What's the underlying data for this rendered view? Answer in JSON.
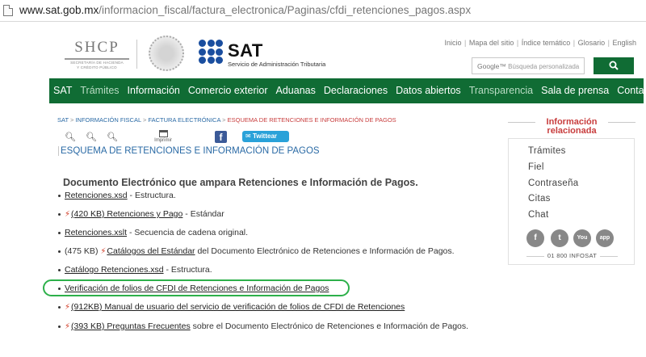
{
  "browser": {
    "url_host": "www.sat.gob.mx",
    "url_path": "/informacion_fiscal/factura_electronica/Paginas/cfdi_retenciones_pagos.aspx"
  },
  "header": {
    "shcp_name": "SHCP",
    "shcp_sub_1": "SECRETARÍA DE HACIENDA",
    "shcp_sub_2": "Y CRÉDITO PÚBLICO",
    "sat_name": "SAT",
    "sat_sub": "Servicio de Administración Tributaria",
    "top_links": [
      "Inicio",
      "Mapa del sitio",
      "Índice temático",
      "Glosario",
      "English"
    ],
    "search_google": "Google™",
    "search_placeholder": "Búsqueda personalizada"
  },
  "nav": {
    "items": [
      "SAT",
      "Trámites",
      "Información",
      "Comercio exterior",
      "Aduanas",
      "Declaraciones",
      "Datos abiertos",
      "Transparencia",
      "Sala de prensa",
      "Contacto"
    ]
  },
  "breadcrumb": {
    "items": [
      "SAT",
      "INFORMACIÓN FISCAL",
      "FACTURA ELECTRÓNICA"
    ],
    "current": "ESQUEMA DE RETENCIONES E INFORMACIÓN DE PAGOS",
    "separator": " > "
  },
  "tools": {
    "print_label": "Imprimir",
    "tweet_label": "Twittear"
  },
  "page_title": "ESQUEMA DE RETENCIONES E INFORMACIÓN DE PAGOS",
  "content": {
    "heading": "Documento Electrónico que ampara Retenciones e Información de Pagos.",
    "items": [
      {
        "prefix": "",
        "link": "Retenciones.xsd",
        "suffix": " - Estructura."
      },
      {
        "prefix": "",
        "link": "(420 KB) Retenciones y Pago",
        "suffix": " - Estándar"
      },
      {
        "prefix": "",
        "link": "Retenciones.xslt",
        "suffix": " - Secuencia de cadena original."
      },
      {
        "prefix": "(475 KB) ",
        "link": "Catálogos del Estándar",
        "suffix": " del Documento Electrónico de Retenciones e Información de Pagos."
      },
      {
        "prefix": "",
        "link": "Catálogo Retenciones.xsd",
        "suffix": " - Estructura."
      },
      {
        "prefix": "",
        "link": "Verificación de folios de CFDI de Retenciones e Información de Pagos",
        "suffix": ""
      },
      {
        "prefix": "",
        "link": "(912KB) Manual de usuario del servicio de verificación de folios de CFDI de Retenciones",
        "suffix": ""
      },
      {
        "prefix": "",
        "link": "(393 KB) Preguntas Frecuentes",
        "suffix": " sobre el Documento Electrónico de Retenciones e Información de Pagos."
      }
    ]
  },
  "sidebar": {
    "title_1": "Información",
    "title_2": "relacionada",
    "items": [
      "Trámites",
      "Fiel",
      "Contraseña",
      "Citas",
      "Chat"
    ],
    "socials": [
      "f",
      "t",
      "You",
      "app"
    ],
    "phone": "01 800 INFOSAT"
  },
  "colors": {
    "brand_green": "#106c34",
    "link_blue": "#2a6aa5",
    "accent_red": "#c83d3d",
    "highlight_green": "#2db04a"
  }
}
